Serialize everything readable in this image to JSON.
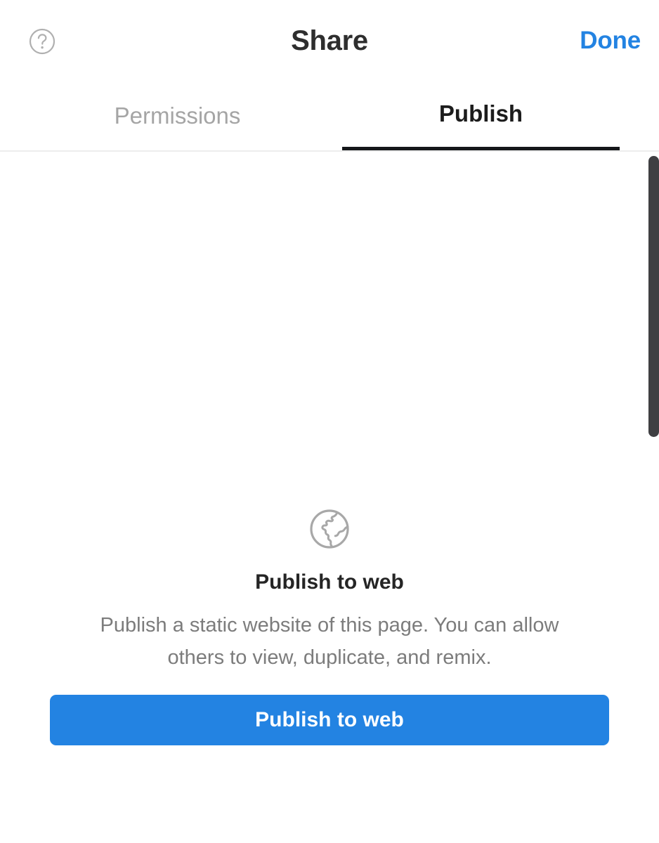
{
  "header": {
    "title": "Share",
    "help_icon": "help-circle-icon",
    "done_label": "Done",
    "done_color": "#2383e2"
  },
  "tabs": [
    {
      "label": "Permissions",
      "active": false
    },
    {
      "label": "Publish",
      "active": true
    }
  ],
  "publish_panel": {
    "icon": "globe-icon",
    "title": "Publish to web",
    "description": "Publish a static website of this page. You can allow others to view, duplicate, and remix.",
    "button_label": "Publish to web",
    "button_color": "#2383e2"
  },
  "scrollbar": {
    "name": "vertical-scrollbar",
    "thumb_color": "#3f3f42"
  }
}
